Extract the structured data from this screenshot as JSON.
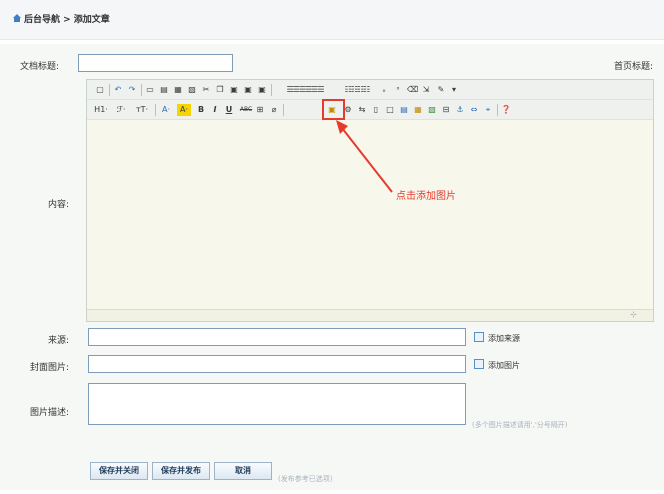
{
  "breadcrumb": {
    "text": "后台导航 > 添加文章"
  },
  "labels": {
    "title": "文档标题:",
    "home_title": "首页标题:",
    "content": "内容:",
    "source": "来源:",
    "cover": "封面图片:",
    "image_desc": "图片描述:"
  },
  "inputs": {
    "title_value": "",
    "source_value": "",
    "cover_value": "",
    "image_desc_value": ""
  },
  "editor": {
    "row2": [
      "H1·",
      "ℱ·",
      "ᴛT·",
      "A·",
      "A·",
      "B",
      "I",
      "U",
      "ABC",
      "⊞",
      "⌀",
      "▣",
      "⚙",
      "⇆",
      "▯",
      "□",
      "▤",
      "▦",
      "▧",
      "⊟",
      "⚓",
      "⇔",
      "⌖",
      "❓"
    ]
  },
  "annotation": {
    "text": "点击添加图片",
    "color": "#e53a2e"
  },
  "links": {
    "add_source": "添加来源",
    "add_image": "添加图片"
  },
  "hints": {
    "image_desc": "(多个图片描述请用','分号隔开)",
    "publish": "(发布参考已选项)"
  },
  "buttons": {
    "save_close": "保存并关闭",
    "save_publish": "保存并发布",
    "cancel": "取消"
  }
}
